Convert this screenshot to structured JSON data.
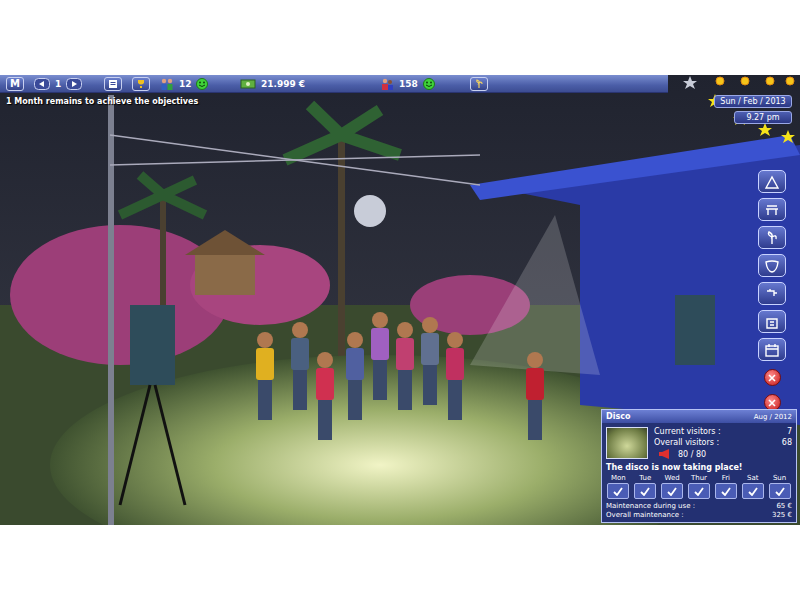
{
  "hud": {
    "menu": "M",
    "page": "1",
    "people": "12",
    "money": "21.999 €",
    "visitors": "158"
  },
  "objective": "1 Month remains to achieve the objectives",
  "clock": {
    "date": "Sun / Feb / 2013",
    "time": "9.27 pm"
  },
  "panel": {
    "title": "Disco",
    "date": "Aug / 2012",
    "stats": [
      {
        "label": "Current visitors :",
        "value": "7"
      },
      {
        "label": "Overall visitors :",
        "value": "68"
      }
    ],
    "capacity": "80 / 80",
    "message": "The disco is now taking place!",
    "days": [
      {
        "label": "Mon",
        "checked": true
      },
      {
        "label": "Tue",
        "checked": true
      },
      {
        "label": "Wed",
        "checked": true
      },
      {
        "label": "Thur",
        "checked": true
      },
      {
        "label": "Fri",
        "checked": true
      },
      {
        "label": "Sat",
        "checked": true
      },
      {
        "label": "Sun",
        "checked": true
      }
    ],
    "costs": [
      {
        "label": "Maintenance during use :",
        "value": "65 €"
      },
      {
        "label": "Overall maintenance :",
        "value": "325 €"
      }
    ]
  }
}
